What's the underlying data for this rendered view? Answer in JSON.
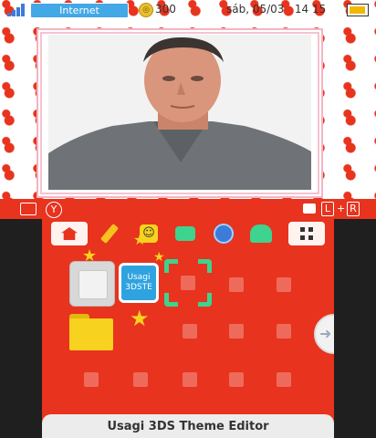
{
  "status": {
    "network": "Internet",
    "coins": "300",
    "date": "sáb, 05/03",
    "time": "14  15"
  },
  "buttons": {
    "left_camera": "◎",
    "y_button": "Y",
    "right_camera": "◎",
    "l_label": "L",
    "plus": "+",
    "r_label": "R"
  },
  "folder_badge": "Usagi\n3DSTE",
  "footer_title": "Usagi 3DS Theme Editor",
  "icons": [
    "settings-home",
    "pencil",
    "smiley",
    "speech",
    "globe",
    "people",
    "toggle"
  ],
  "colors": {
    "accent": "#e8331e",
    "selection": "#3ed38e",
    "folder": "#f7d21e"
  }
}
